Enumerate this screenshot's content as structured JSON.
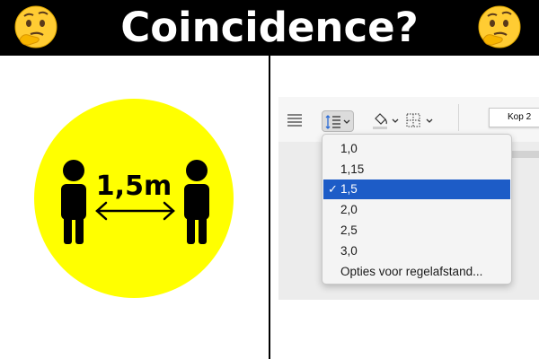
{
  "banner": {
    "title": "Coincidence?",
    "left_icon": "thinking-face-emoji",
    "right_icon": "thinking-face-emoji",
    "background": "#000000",
    "text_color": "#ffffff"
  },
  "sign": {
    "label": "1,5m",
    "background": "#ffff00",
    "icons": [
      "person-icon",
      "double-arrow-icon",
      "person-icon"
    ]
  },
  "toolbar": {
    "align_icon": "align-justify-icon",
    "spacing_icon": "line-spacing-icon",
    "shading_icon": "paint-bucket-icon",
    "borders_icon": "borders-icon",
    "style_chip": "Kop 2"
  },
  "dropdown": {
    "items": [
      {
        "label": "1,0",
        "selected": false
      },
      {
        "label": "1,15",
        "selected": false
      },
      {
        "label": "1,5",
        "selected": true
      },
      {
        "label": "2,0",
        "selected": false
      },
      {
        "label": "2,5",
        "selected": false
      },
      {
        "label": "3,0",
        "selected": false
      },
      {
        "label": "Opties voor regelafstand...",
        "selected": false
      }
    ],
    "check_glyph": "✓",
    "selected_color": "#1d5cc7"
  }
}
